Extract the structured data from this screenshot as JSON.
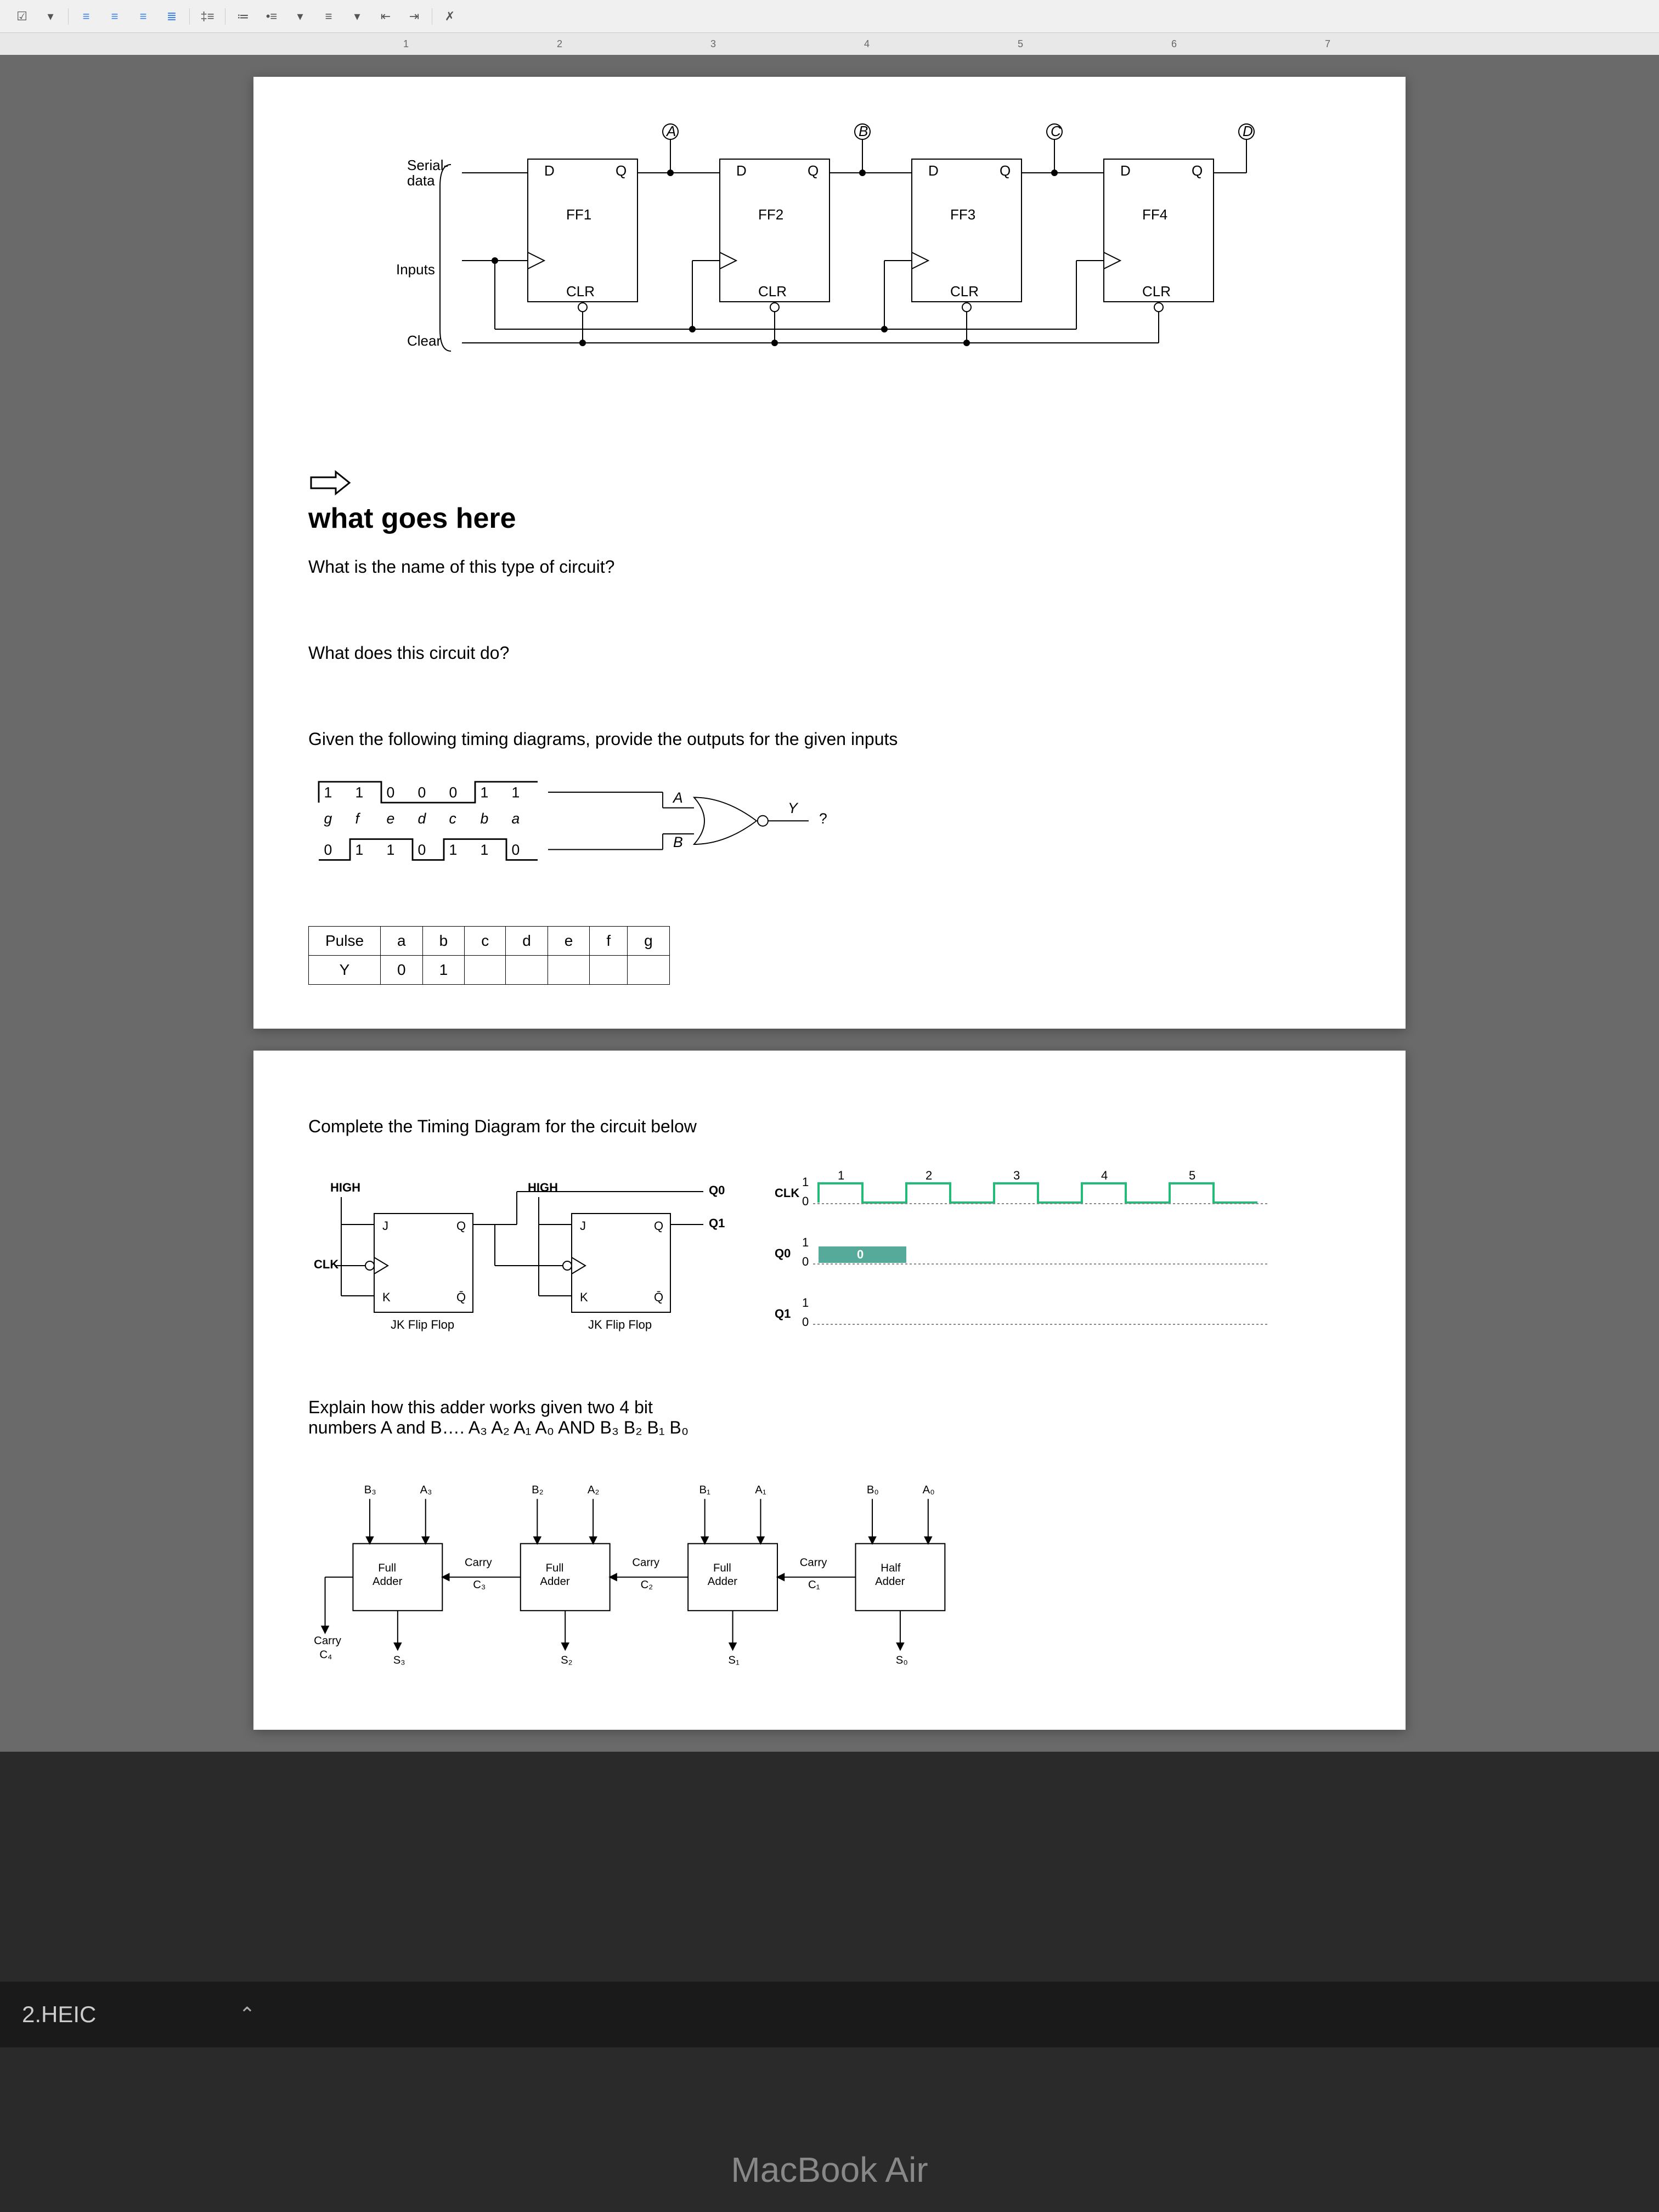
{
  "toolbar": {
    "icons": [
      "checklist",
      "align-left",
      "align-center",
      "align-right",
      "justify",
      "spacing",
      "numbered-list",
      "bullet-list",
      "outdent",
      "indent",
      "clear"
    ]
  },
  "ruler": {
    "marks": [
      "1",
      "2",
      "3",
      "4",
      "5",
      "6",
      "7"
    ]
  },
  "doc": {
    "shift_register": {
      "labels": {
        "serial_data": "Serial-\ndata",
        "inputs": "Inputs",
        "clear": "Clear",
        "ff": [
          "FF1",
          "FF2",
          "FF3",
          "FF4"
        ],
        "d": "D",
        "q": "Q",
        "clr": "CLR",
        "outputs": [
          "A",
          "B",
          "C",
          "D"
        ]
      }
    },
    "callout": "what goes here",
    "q1": "What is the name of this type of circuit?",
    "q2": "What does this circuit do?",
    "q3": "Given the following timing diagrams, provide the outputs for the given inputs",
    "timing_inputs": {
      "row_a": [
        "1",
        "1",
        "0",
        "0",
        "0",
        "1",
        "1"
      ],
      "row_labels": [
        "g",
        "f",
        "e",
        "d",
        "c",
        "b",
        "a"
      ],
      "row_b": [
        "0",
        "1",
        "1",
        "0",
        "1",
        "1",
        "0"
      ],
      "gate_a": "A",
      "gate_b": "B",
      "gate_y": "Y",
      "gate_q": "?"
    },
    "pulse_table": {
      "header": [
        "Pulse",
        "a",
        "b",
        "c",
        "d",
        "e",
        "f",
        "g"
      ],
      "row": [
        "Y",
        "0",
        "1",
        "",
        "",
        "",
        "",
        ""
      ]
    },
    "page2": {
      "q4": "Complete the Timing Diagram for the circuit below",
      "jk": {
        "high": "HIGH",
        "clk": "CLK",
        "j": "J",
        "k": "K",
        "q": "Q",
        "qbar": "Q̄",
        "label": "JK Flip Flop",
        "q0": "Q0",
        "q1": "Q1",
        "clk_lbl": "CLK",
        "one": "1",
        "zero": "0",
        "ticks": [
          "1",
          "2",
          "3",
          "4",
          "5"
        ]
      },
      "q5_line1": "Explain how this adder works given two 4 bit",
      "q5_line2": "numbers A and B…. A₃ A₂ A₁ A₀  AND  B₃ B₂ B₁ B₀",
      "adder": {
        "full": "Full\nAdder",
        "half": "Half\nAdder",
        "carry": "Carry",
        "c": [
          "C₃",
          "C₂",
          "C₁"
        ],
        "cout": "C₄",
        "ab": [
          [
            "B₃",
            "A₃"
          ],
          [
            "B₂",
            "A₂"
          ],
          [
            "B₁",
            "A₁"
          ],
          [
            "B₀",
            "A₀"
          ]
        ],
        "s": [
          "S₃",
          "S₂",
          "S₁",
          "S₀"
        ]
      }
    }
  },
  "footer": {
    "filename": "2.HEIC"
  },
  "device": "MacBook Air"
}
